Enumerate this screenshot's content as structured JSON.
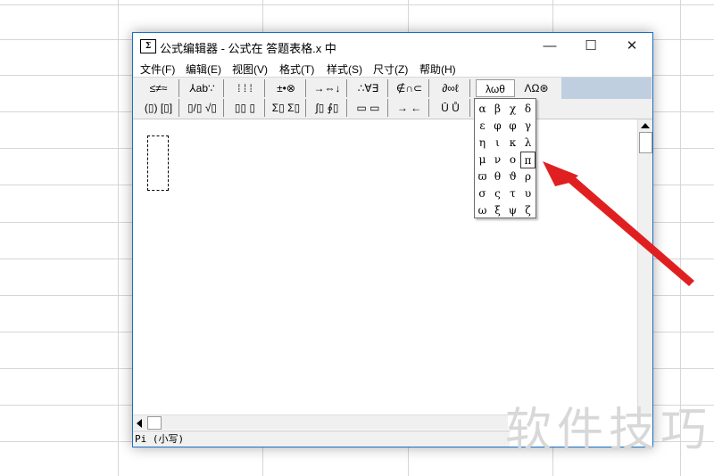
{
  "window": {
    "title": "公式编辑器 - 公式在 答题表格.x 中",
    "icon_label": "Σ",
    "minimize": "—",
    "maximize": "☐",
    "close": "✕"
  },
  "menu": [
    "文件(F)",
    "编辑(E)",
    "视图(V)",
    "格式(T)",
    "样式(S)",
    "尺寸(Z)",
    "帮助(H)"
  ],
  "toolbar_row1": [
    "≤≠≈",
    "⅄ab∵",
    "⁞ ⁞ ⁞",
    "±•⊗",
    "→⇔↓",
    "∴∀∃",
    "∉∩⊂",
    "∂∞ℓ",
    "λωθ",
    "ΛΩ⊛"
  ],
  "toolbar_row2": [
    "(▯) [▯]",
    "▯/▯ √▯",
    "▯▯ ▯",
    "Σ▯ Σ▯",
    "∫▯ ∮▯",
    "▭ ▭",
    "→ ←",
    "Ū Ů",
    "",
    ""
  ],
  "greek_palette": {
    "rows": [
      [
        "α",
        "β",
        "χ",
        "δ"
      ],
      [
        "ε",
        "φ",
        "φ",
        "γ"
      ],
      [
        "η",
        "ι",
        "κ",
        "λ"
      ],
      [
        "μ",
        "ν",
        "ο",
        "π"
      ],
      [
        "ϖ",
        "θ",
        "ϑ",
        "ρ"
      ],
      [
        "σ",
        "ς",
        "τ",
        "υ"
      ],
      [
        "ω",
        "ξ",
        "ψ",
        "ζ"
      ]
    ],
    "selected": "π"
  },
  "status": "Pi (小写)",
  "watermark": "软件技巧",
  "colors": {
    "window_border": "#1a6fc4",
    "arrow": "#e02020",
    "toolbar_highlight": "#bfcfe0"
  }
}
